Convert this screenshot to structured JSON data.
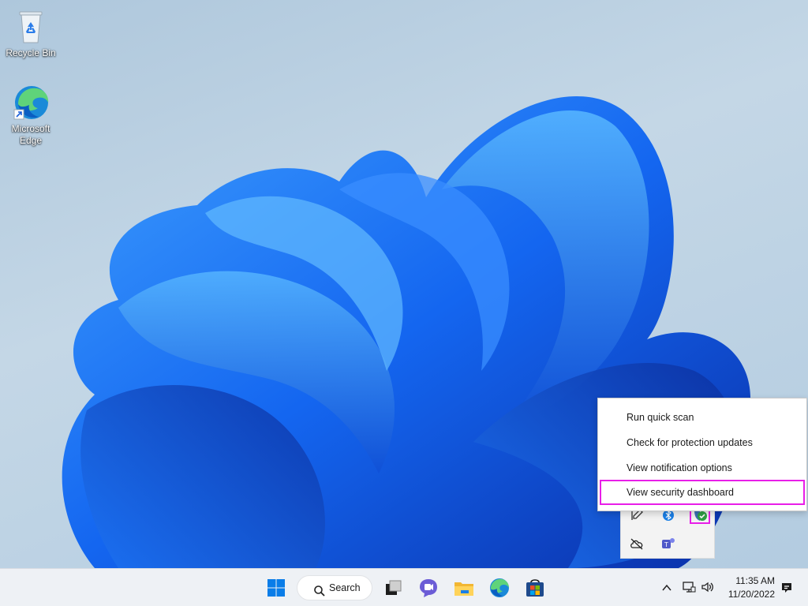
{
  "desktop": {
    "icons": [
      {
        "label": "Recycle Bin",
        "icon": "recycle-bin-icon"
      },
      {
        "label": "Microsoft Edge",
        "icon": "edge-icon"
      }
    ]
  },
  "context_menu": {
    "items": [
      {
        "label": "Run quick scan",
        "highlighted": false
      },
      {
        "label": "Check for protection updates",
        "highlighted": false
      },
      {
        "label": "View notification options",
        "highlighted": false
      },
      {
        "label": "View security dashboard",
        "highlighted": true
      }
    ],
    "highlight_color": "#e81ee8"
  },
  "tray_flyout": {
    "icons": [
      "pen-icon",
      "bluetooth-icon",
      "windows-security-icon",
      "onedrive-offline-icon",
      "teams-icon"
    ]
  },
  "taskbar": {
    "search_label": "Search",
    "apps": [
      "start-icon",
      "search-icon",
      "task-view-icon",
      "chat-icon",
      "file-explorer-icon",
      "edge-icon",
      "store-icon"
    ],
    "clock": {
      "time": "11:35 AM",
      "date": "11/20/2022"
    }
  },
  "colors": {
    "accent": "#0067c0",
    "wallpaper": "#1556e6"
  }
}
